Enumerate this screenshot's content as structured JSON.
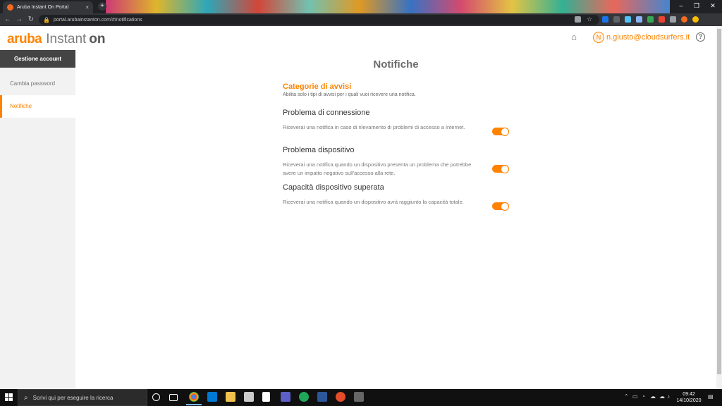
{
  "browser": {
    "tab_title": "Aruba Instant On Portal",
    "tab_close": "×",
    "new_tab": "+",
    "url": "portal.arubainstanton.com/#/notifications",
    "nav": {
      "back": "←",
      "forward": "→",
      "reload": "↻"
    },
    "window": {
      "minimize": "–",
      "maximize": "❐",
      "close": "✕"
    }
  },
  "header": {
    "brand": "aruba",
    "product": "Instant",
    "product_on": "on",
    "avatar_initial": "N",
    "user": "n.giusto@cloudsurfers.it",
    "home_icon": "⌂",
    "help_icon": "?"
  },
  "sidebar": {
    "title": "Gestione account",
    "items": [
      {
        "label": "Cambia password"
      },
      {
        "label": "Notifiche"
      }
    ]
  },
  "main": {
    "title": "Notifiche",
    "section_title": "Categorie di avvisi",
    "section_subtitle": "Abilita solo i tipi di avvisi per i quali vuoi ricevere una notifica.",
    "categories": [
      {
        "name": "Problema di connessione",
        "description": "Riceverai una notifica in caso di rilevamento di problemi di accesso a Internet.",
        "enabled": true
      },
      {
        "name": "Problema dispositivo",
        "description": "Riceverai una notifica quando un dispositivo presenta un problema che potrebbe avere un impatto negativo sull'accesso alla rete.",
        "enabled": true
      },
      {
        "name": "Capacità dispositivo superata",
        "description": "Riceverai una notifica quando un dispositivo avrà raggiunto la capacità totale.",
        "enabled": true
      }
    ]
  },
  "taskbar": {
    "search_placeholder": "Scrivi qui per eseguire la ricerca",
    "time": "09:42",
    "date": "14/10/2020",
    "tray_chevron": "⌃"
  },
  "colors": {
    "accent": "#ff8300",
    "sidebar_header": "#444444",
    "sidebar_bg": "#f2f2f2"
  }
}
